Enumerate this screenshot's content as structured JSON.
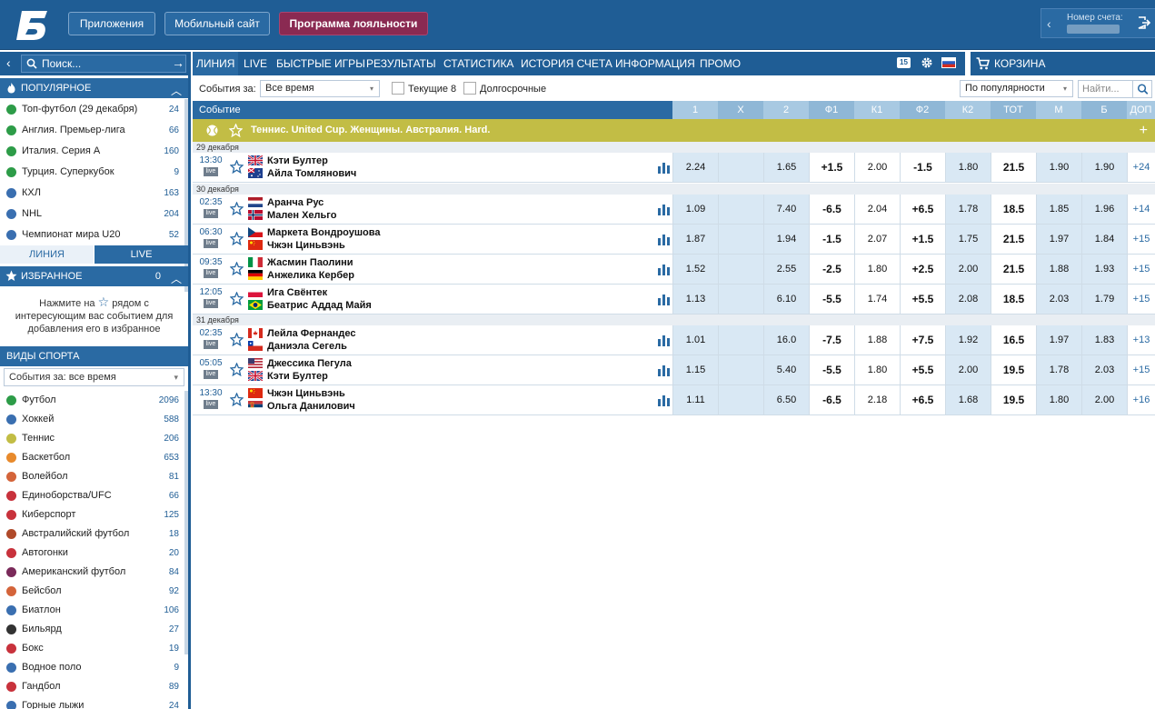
{
  "header": {
    "buttons": [
      "Приложения",
      "Мобильный сайт",
      "Программа лояльности"
    ],
    "account_label": "Номер счета:"
  },
  "sidebar": {
    "search_placeholder": "Поиск...",
    "popular_title": "ПОПУЛЯРНОЕ",
    "popular": [
      {
        "label": "Топ-футбол (29 декабря)",
        "count": "24",
        "icon": "football-icon",
        "color": "#2d9c48"
      },
      {
        "label": "Англия. Премьер-лига",
        "count": "66",
        "icon": "football-icon",
        "color": "#2d9c48"
      },
      {
        "label": "Италия. Серия А",
        "count": "160",
        "icon": "football-icon",
        "color": "#2d9c48"
      },
      {
        "label": "Турция. Суперкубок",
        "count": "9",
        "icon": "football-icon",
        "color": "#2d9c48"
      },
      {
        "label": "КХЛ",
        "count": "163",
        "icon": "hockey-puck-icon",
        "color": "#3a6fb0"
      },
      {
        "label": "NHL",
        "count": "204",
        "icon": "hockey-puck-icon",
        "color": "#3a6fb0"
      },
      {
        "label": "Чемпионат мира U20",
        "count": "52",
        "icon": "hockey-puck-icon",
        "color": "#3a6fb0"
      }
    ],
    "tabs": {
      "line": "ЛИНИЯ",
      "live": "LIVE"
    },
    "favorites_title": "ИЗБРАННОЕ",
    "favorites_count": "0",
    "favorites_hint_pre": "Нажмите на",
    "favorites_hint_post": "рядом с интересующим вас событием для добавления его в избранное",
    "sports_title": "ВИДЫ СПОРТА",
    "sports_filter": "События за: все время",
    "sports": [
      {
        "label": "Футбол",
        "count": "2096",
        "icon": "football-icon",
        "color": "#2d9c48"
      },
      {
        "label": "Хоккей",
        "count": "588",
        "icon": "hockey-puck-icon",
        "color": "#3a6fb0"
      },
      {
        "label": "Теннис",
        "count": "206",
        "icon": "tennis-ball-icon",
        "color": "#c2bd45"
      },
      {
        "label": "Баскетбол",
        "count": "653",
        "icon": "basketball-icon",
        "color": "#e88a2c"
      },
      {
        "label": "Волейбол",
        "count": "81",
        "icon": "volleyball-icon",
        "color": "#d4643a"
      },
      {
        "label": "Единоборства/UFC",
        "count": "66",
        "icon": "fighting-icon",
        "color": "#c8323c"
      },
      {
        "label": "Киберспорт",
        "count": "125",
        "icon": "esports-icon",
        "color": "#c8323c"
      },
      {
        "label": "Австралийский футбол",
        "count": "18",
        "icon": "aussie-football-icon",
        "color": "#b04a2a"
      },
      {
        "label": "Автогонки",
        "count": "20",
        "icon": "racing-flag-icon",
        "color": "#c8323c"
      },
      {
        "label": "Американский футбол",
        "count": "84",
        "icon": "american-football-icon",
        "color": "#7a2a5a"
      },
      {
        "label": "Бейсбол",
        "count": "92",
        "icon": "baseball-icon",
        "color": "#d4643a"
      },
      {
        "label": "Биатлон",
        "count": "106",
        "icon": "biathlon-icon",
        "color": "#3a6fb0"
      },
      {
        "label": "Бильярд",
        "count": "27",
        "icon": "billiard-ball-icon",
        "color": "#333333"
      },
      {
        "label": "Бокс",
        "count": "19",
        "icon": "boxing-glove-icon",
        "color": "#c8323c"
      },
      {
        "label": "Водное поло",
        "count": "9",
        "icon": "water-polo-icon",
        "color": "#3a6fb0"
      },
      {
        "label": "Гандбол",
        "count": "89",
        "icon": "handball-icon",
        "color": "#c8323c"
      },
      {
        "label": "Горные лыжи",
        "count": "24",
        "icon": "skiing-icon",
        "color": "#3a6fb0"
      }
    ]
  },
  "nav": {
    "items": [
      "ЛИНИЯ",
      "LIVE",
      "БЫСТРЫЕ ИГРЫ",
      "РЕЗУЛЬТАТЫ",
      "СТАТИСТИКА",
      "ИСТОРИЯ СЧЕТА",
      "ИНФОРМАЦИЯ",
      "ПРОМО"
    ],
    "badge": "15",
    "cart": "КОРЗИНА"
  },
  "filters": {
    "events_for_label": "События за:",
    "events_for_value": "Все время",
    "current8": "Текущие 8",
    "longterm": "Долгосрочные",
    "sort_value": "По популярности",
    "search_placeholder": "Найти..."
  },
  "table": {
    "event_header": "Событие",
    "columns": [
      "1",
      "X",
      "2",
      "Ф1",
      "К1",
      "Ф2",
      "К2",
      "ТОТ",
      "М",
      "Б",
      "ДОП"
    ],
    "tournament": "Теннис. United Cup. Женщины. Австралия. Hard.",
    "live_label": "live",
    "dates": [
      "29 декабря",
      "30 декабря",
      "31 декабря"
    ],
    "events": [
      {
        "time": "13:30",
        "p1": "Кэти Бултер",
        "p2": "Айла Томлянович",
        "odds": [
          "2.24",
          "",
          "1.65",
          "+1.5",
          "2.00",
          "-1.5",
          "1.80",
          "21.5",
          "1.90",
          "1.90",
          "+24"
        ]
      },
      {
        "time": "02:35",
        "p1": "Аранча Рус",
        "p2": "Мален Хельго",
        "odds": [
          "1.09",
          "",
          "7.40",
          "-6.5",
          "2.04",
          "+6.5",
          "1.78",
          "18.5",
          "1.85",
          "1.96",
          "+14"
        ]
      },
      {
        "time": "06:30",
        "p1": "Маркета Вондроушова",
        "p2": "Чжэн Циньвэнь",
        "odds": [
          "1.87",
          "",
          "1.94",
          "-1.5",
          "2.07",
          "+1.5",
          "1.75",
          "21.5",
          "1.97",
          "1.84",
          "+15"
        ]
      },
      {
        "time": "09:35",
        "p1": "Жасмин Паолини",
        "p2": "Анжелика Кербер",
        "odds": [
          "1.52",
          "",
          "2.55",
          "-2.5",
          "1.80",
          "+2.5",
          "2.00",
          "21.5",
          "1.88",
          "1.93",
          "+15"
        ]
      },
      {
        "time": "12:05",
        "p1": "Ига Свёнтек",
        "p2": "Беатрис Аддад Майя",
        "odds": [
          "1.13",
          "",
          "6.10",
          "-5.5",
          "1.74",
          "+5.5",
          "2.08",
          "18.5",
          "2.03",
          "1.79",
          "+15"
        ]
      },
      {
        "time": "02:35",
        "p1": "Лейла Фернандес",
        "p2": "Даниэла Сегель",
        "odds": [
          "1.01",
          "",
          "16.0",
          "-7.5",
          "1.88",
          "+7.5",
          "1.92",
          "16.5",
          "1.97",
          "1.83",
          "+13"
        ]
      },
      {
        "time": "05:05",
        "p1": "Джессика Пегула",
        "p2": "Кэти Бултер",
        "odds": [
          "1.15",
          "",
          "5.40",
          "-5.5",
          "1.80",
          "+5.5",
          "2.00",
          "19.5",
          "1.78",
          "2.03",
          "+15"
        ]
      },
      {
        "time": "13:30",
        "p1": "Чжэн Циньвэнь",
        "p2": "Ольга Данилович",
        "odds": [
          "1.11",
          "",
          "6.50",
          "-6.5",
          "2.18",
          "+6.5",
          "1.68",
          "19.5",
          "1.80",
          "2.00",
          "+16"
        ]
      }
    ]
  },
  "colors": {
    "primary": "#1f5d95",
    "accent": "#2a6aa3",
    "loyalty": "#8a2a52",
    "tournament": "#c2bd45",
    "odds_alt": "#d9e8f4"
  }
}
